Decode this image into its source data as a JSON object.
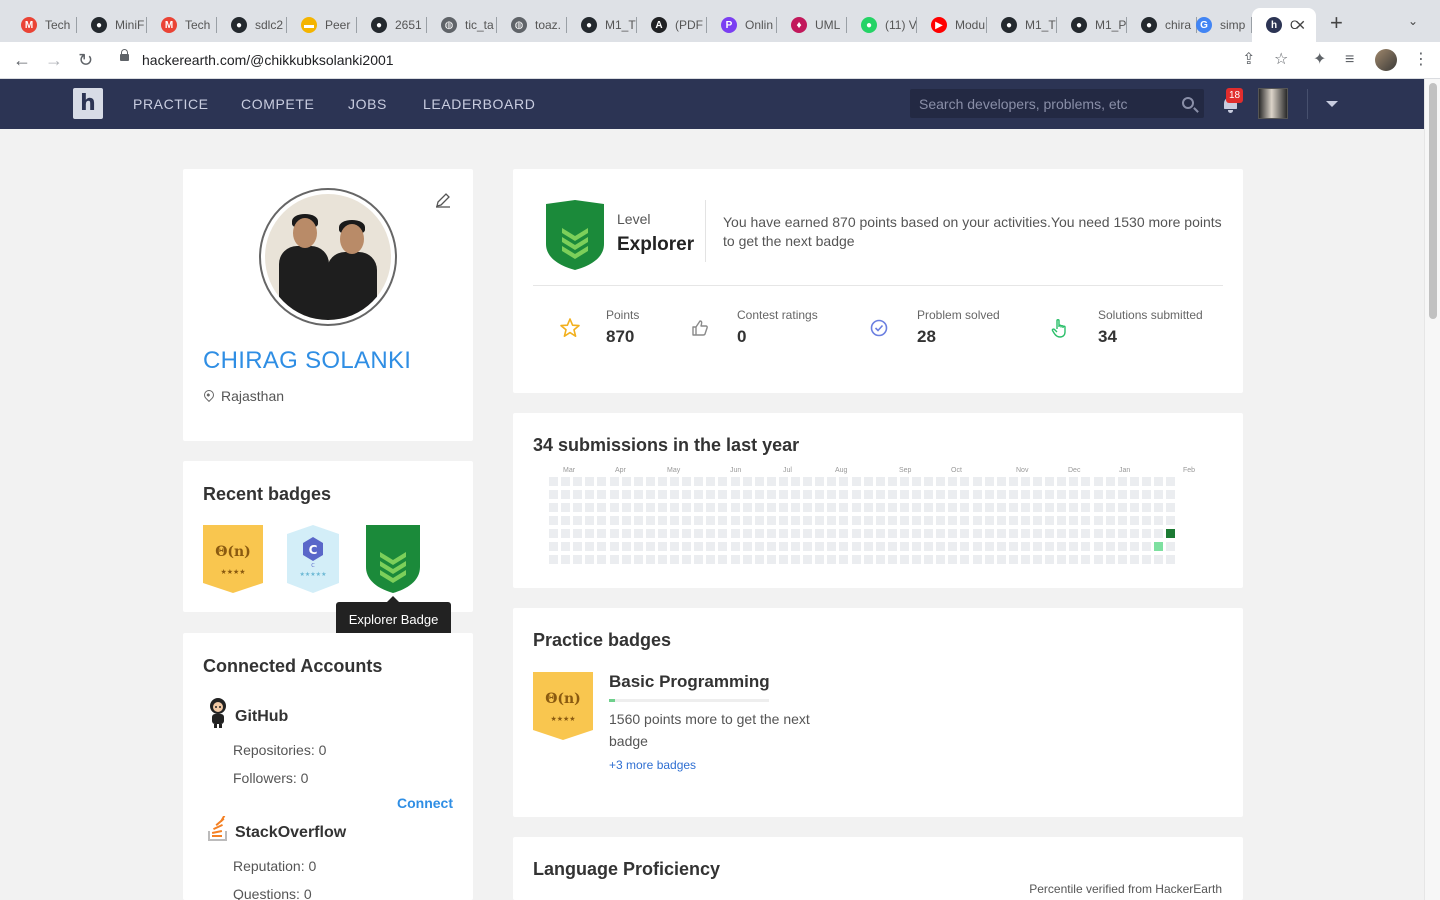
{
  "browser": {
    "tabs": [
      {
        "label": "Tech",
        "icon": "gmail-icon",
        "color": "#ea4335",
        "glyph": "M"
      },
      {
        "label": "MiniF",
        "icon": "github-icon",
        "color": "#24292e",
        "glyph": "●"
      },
      {
        "label": "Tech",
        "icon": "gmail-icon",
        "color": "#ea4335",
        "glyph": "M"
      },
      {
        "label": "sdlc2",
        "icon": "github-icon",
        "color": "#24292e",
        "glyph": "●"
      },
      {
        "label": "Peer",
        "icon": "folder-icon",
        "color": "#f4b400",
        "glyph": "▬"
      },
      {
        "label": "2651",
        "icon": "github-icon",
        "color": "#24292e",
        "glyph": "●"
      },
      {
        "label": "tic_ta",
        "icon": "globe-icon",
        "color": "#5f6368",
        "glyph": "◍"
      },
      {
        "label": "toaz.",
        "icon": "globe-icon",
        "color": "#5f6368",
        "glyph": "◍"
      },
      {
        "label": "M1_T",
        "icon": "github-icon",
        "color": "#24292e",
        "glyph": "●"
      },
      {
        "label": "(PDF",
        "icon": "academia-icon",
        "color": "#202124",
        "glyph": "A"
      },
      {
        "label": "Onlin",
        "icon": "p-icon",
        "color": "#7b3ff2",
        "glyph": "P"
      },
      {
        "label": "UML",
        "icon": "uml-icon",
        "color": "#c2185b",
        "glyph": "♦"
      },
      {
        "label": "(11) V",
        "icon": "whatsapp-icon",
        "color": "#25d366",
        "glyph": "●"
      },
      {
        "label": "Modu",
        "icon": "youtube-icon",
        "color": "#ff0000",
        "glyph": "▶"
      },
      {
        "label": "M1_T",
        "icon": "github-icon",
        "color": "#24292e",
        "glyph": "●"
      },
      {
        "label": "M1_P",
        "icon": "github-icon",
        "color": "#24292e",
        "glyph": "●"
      },
      {
        "label": "chira",
        "icon": "github-icon",
        "color": "#24292e",
        "glyph": "●"
      },
      {
        "label": "simp",
        "icon": "google-icon",
        "color": "#4285f4",
        "glyph": "G"
      },
      {
        "label": "C",
        "icon": "hackerearth-icon",
        "color": "#2c3454",
        "glyph": "h"
      }
    ],
    "new_tab": "+",
    "close_tab": "✕",
    "url": "hackerearth.com/@chikkubksolanki2001"
  },
  "nav": {
    "logo": "h",
    "links": [
      "PRACTICE",
      "COMPETE",
      "JOBS",
      "LEADERBOARD"
    ],
    "search_placeholder": "Search developers, problems, etc",
    "notifications": "18"
  },
  "profile": {
    "name": "CHIRAG SOLANKI",
    "location": "Rajasthan"
  },
  "recent_badges": {
    "title": "Recent badges",
    "badges": [
      {
        "label": "Θ(n)",
        "stars": "★★★★",
        "icon": "basic-programming-badge-icon"
      },
      {
        "label": "C",
        "stars": "★★★★★",
        "icon": "c-language-badge-icon"
      },
      {
        "label": "",
        "icon": "explorer-badge-icon"
      }
    ],
    "tooltip": "Explorer Badge"
  },
  "accounts": {
    "title": "Connected Accounts",
    "github": {
      "name": "GitHub",
      "repos": "Repositories: 0",
      "followers": "Followers: 0",
      "connect": "Connect"
    },
    "stackoverflow": {
      "name": "StackOverflow",
      "reputation": "Reputation: 0",
      "questions": "Questions: 0"
    }
  },
  "level": {
    "label": "Level",
    "value": "Explorer",
    "message": "You have earned 870 points based on your activities.You need 1530 more points to get the next badge",
    "stats": [
      {
        "label": "Points",
        "value": "870",
        "icon": "star-icon",
        "bg": "#fdf3d8",
        "fg": "#f2b01e"
      },
      {
        "label": "Contest ratings",
        "value": "0",
        "icon": "thumbs-up-icon",
        "bg": "#e7e7e7",
        "fg": "#8a8a8a"
      },
      {
        "label": "Problem solved",
        "value": "28",
        "icon": "check-circle-icon",
        "bg": "#e6ebfb",
        "fg": "#6b7fe0"
      },
      {
        "label": "Solutions submitted",
        "value": "34",
        "icon": "pointer-hand-icon",
        "bg": "#e3f8ec",
        "fg": "#2bbf6a"
      }
    ]
  },
  "submissions": {
    "title": "34 submissions in the last year",
    "months": [
      "Mar",
      "Apr",
      "May",
      "Jun",
      "Jul",
      "Aug",
      "Sep",
      "Oct",
      "Nov",
      "Dec",
      "Jan",
      "Feb"
    ],
    "active_cells": [
      {
        "week": 50,
        "day": 5,
        "level": 1
      },
      {
        "week": 51,
        "day": 4,
        "level": 4
      },
      {
        "week": 51,
        "day": 7,
        "level": 1
      }
    ],
    "colors": {
      "empty": "#ebedf0",
      "low": "#7ee0a0",
      "high": "#1c7a33"
    }
  },
  "practice": {
    "title": "Practice badges",
    "badge_label": "Θ(n)",
    "badge_stars": "★★★★",
    "badge_name": "Basic Programming",
    "progress": 0.04,
    "message": "1560 points more to get the next badge",
    "more": "+3 more badges"
  },
  "language": {
    "title": "Language Proficiency",
    "note": "Percentile verified from HackerEarth"
  }
}
